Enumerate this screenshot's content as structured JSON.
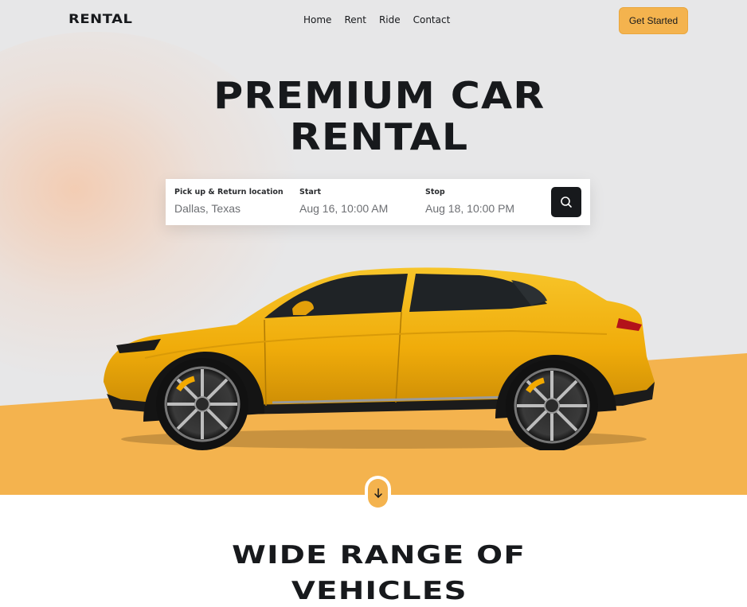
{
  "nav": {
    "logo": "RENTAL",
    "links": [
      "Home",
      "Rent",
      "Ride",
      "Contact"
    ],
    "cta_label": "Get Started"
  },
  "hero": {
    "title_line1": "PREMIUM CAR",
    "title_line2": "RENTAL"
  },
  "search": {
    "location_label": "Pick up & Return location",
    "location_value": "Dallas, Texas",
    "start_label": "Start",
    "start_value": "Aug 16, 10:00 AM",
    "stop_label": "Stop",
    "stop_value": "Aug 18, 10:00 PM",
    "button_icon": "search-icon"
  },
  "scroll_button_icon": "arrow-down-icon",
  "section": {
    "title_line1": "WIDE RANGE OF",
    "title_line2": "VEHICLES"
  },
  "colors": {
    "accent": "#f4b34e",
    "dark": "#17191c",
    "hero_bg": "#e7e7e8",
    "car_body": "#f2b20c"
  }
}
